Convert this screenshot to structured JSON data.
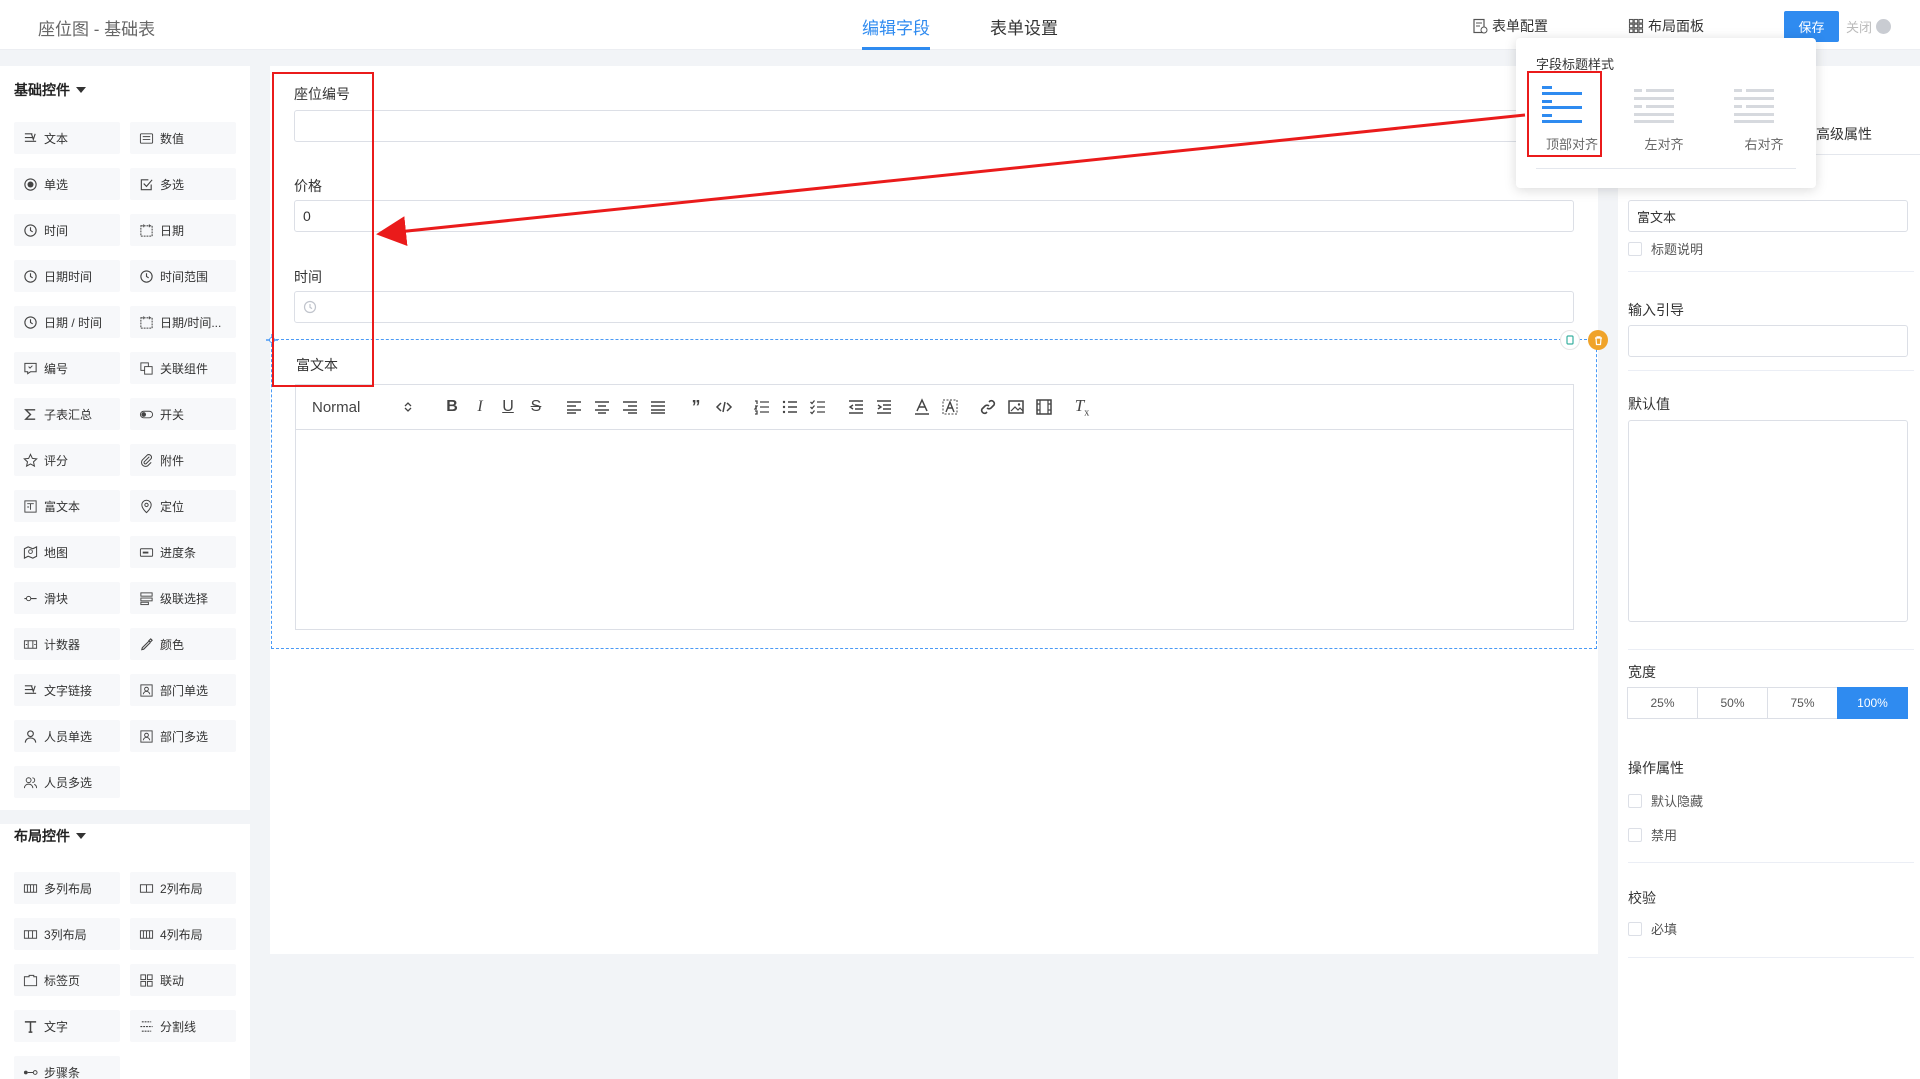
{
  "header": {
    "title": "座位图 - 基础表",
    "tabs": [
      {
        "label": "编辑字段",
        "active": true
      },
      {
        "label": "表单设置",
        "active": false
      }
    ],
    "form_config": "表单配置",
    "layout_panel": "布局面板",
    "save": "保存",
    "close": "关闭"
  },
  "left": {
    "basic_title": "基础控件",
    "basic_items": [
      {
        "label": "文本",
        "icon": "text-icon"
      },
      {
        "label": "数值",
        "icon": "number-icon"
      },
      {
        "label": "单选",
        "icon": "radio-icon"
      },
      {
        "label": "多选",
        "icon": "checkbox-icon"
      },
      {
        "label": "时间",
        "icon": "clock-icon"
      },
      {
        "label": "日期",
        "icon": "calendar-icon"
      },
      {
        "label": "日期时间",
        "icon": "clock-icon"
      },
      {
        "label": "时间范围",
        "icon": "clock-icon"
      },
      {
        "label": "日期 / 时间",
        "icon": "clock-icon"
      },
      {
        "label": "日期/时间...",
        "icon": "calendar-icon"
      },
      {
        "label": "编号",
        "icon": "serial-icon"
      },
      {
        "label": "关联组件",
        "icon": "link-component-icon"
      },
      {
        "label": "子表汇总",
        "icon": "sigma-icon"
      },
      {
        "label": "开关",
        "icon": "switch-icon"
      },
      {
        "label": "评分",
        "icon": "star-icon"
      },
      {
        "label": "附件",
        "icon": "paperclip-icon"
      },
      {
        "label": "富文本",
        "icon": "richtext-icon"
      },
      {
        "label": "定位",
        "icon": "location-icon"
      },
      {
        "label": "地图",
        "icon": "map-icon"
      },
      {
        "label": "进度条",
        "icon": "progress-icon"
      },
      {
        "label": "滑块",
        "icon": "slider-icon"
      },
      {
        "label": "级联选择",
        "icon": "cascade-icon"
      },
      {
        "label": "计数器",
        "icon": "counter-icon"
      },
      {
        "label": "颜色",
        "icon": "color-picker-icon"
      },
      {
        "label": "文字链接",
        "icon": "text-icon"
      },
      {
        "label": "部门单选",
        "icon": "department-icon"
      },
      {
        "label": "人员单选",
        "icon": "user-icon"
      },
      {
        "label": "部门多选",
        "icon": "department-icon"
      },
      {
        "label": "人员多选",
        "icon": "users-icon"
      }
    ],
    "layout_title": "布局控件",
    "layout_items": [
      {
        "label": "多列布局",
        "icon": "columns-icon"
      },
      {
        "label": "2列布局",
        "icon": "two-columns-icon"
      },
      {
        "label": "3列布局",
        "icon": "three-columns-icon"
      },
      {
        "label": "4列布局",
        "icon": "four-columns-icon"
      },
      {
        "label": "标签页",
        "icon": "tabs-icon"
      },
      {
        "label": "联动",
        "icon": "grid-icon"
      },
      {
        "label": "文字",
        "icon": "type-icon"
      },
      {
        "label": "分割线",
        "icon": "divider-icon"
      },
      {
        "label": "步骤条",
        "icon": "steps-icon"
      }
    ]
  },
  "canvas": {
    "fields": [
      {
        "label": "座位编号",
        "value": ""
      },
      {
        "label": "价格",
        "value": "0"
      },
      {
        "label": "时间",
        "value": ""
      }
    ],
    "rich_label": "富文本",
    "rich_select": "Normal"
  },
  "right": {
    "advanced_tab": "高级属性",
    "title_value": "富文本",
    "title_desc": "标题说明",
    "placeholder_label": "输入引导",
    "default_label": "默认值",
    "width_label": "宽度",
    "widths": [
      "25%",
      "50%",
      "75%",
      "100%"
    ],
    "width_active": "100%",
    "ops_label": "操作属性",
    "hide_label": "默认隐藏",
    "disable_label": "禁用",
    "validate_label": "校验",
    "required_label": "必填"
  },
  "popover": {
    "title": "字段标题样式",
    "options": [
      "顶部对齐",
      "左对齐",
      "右对齐"
    ]
  },
  "colors": {
    "accent": "#2f8bf0",
    "annotation": "#ea1b1b",
    "delete": "#f0a32a"
  }
}
